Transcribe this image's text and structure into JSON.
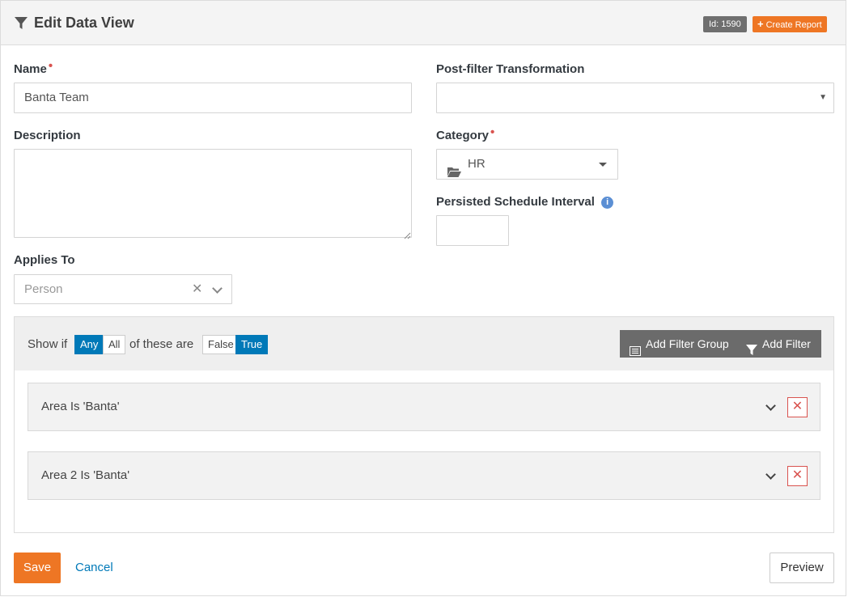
{
  "header": {
    "title": "Edit Data View",
    "id_badge": "Id: 1590",
    "create_report_label": "Create Report"
  },
  "form": {
    "name": {
      "label": "Name",
      "value": "Banta Team"
    },
    "post_filter": {
      "label": "Post-filter Transformation",
      "value": ""
    },
    "description": {
      "label": "Description",
      "value": ""
    },
    "category": {
      "label": "Category",
      "value": "HR"
    },
    "persisted_schedule": {
      "label": "Persisted Schedule Interval",
      "value": ""
    },
    "applies_to": {
      "label": "Applies To",
      "value": "Person"
    }
  },
  "filter": {
    "show_if": "Show if",
    "any": "Any",
    "all": "All",
    "of_these_are": "of these are",
    "false": "False",
    "true": "True",
    "add_filter_group": "Add Filter Group",
    "add_filter": "Add Filter",
    "rows": [
      {
        "text": "Area Is 'Banta'"
      },
      {
        "text": "Area 2 Is 'Banta'"
      }
    ]
  },
  "actions": {
    "save": "Save",
    "cancel": "Cancel",
    "preview": "Preview"
  },
  "colors": {
    "accent": "#ee7624",
    "primary": "#0079b8",
    "danger": "#d9534f"
  }
}
